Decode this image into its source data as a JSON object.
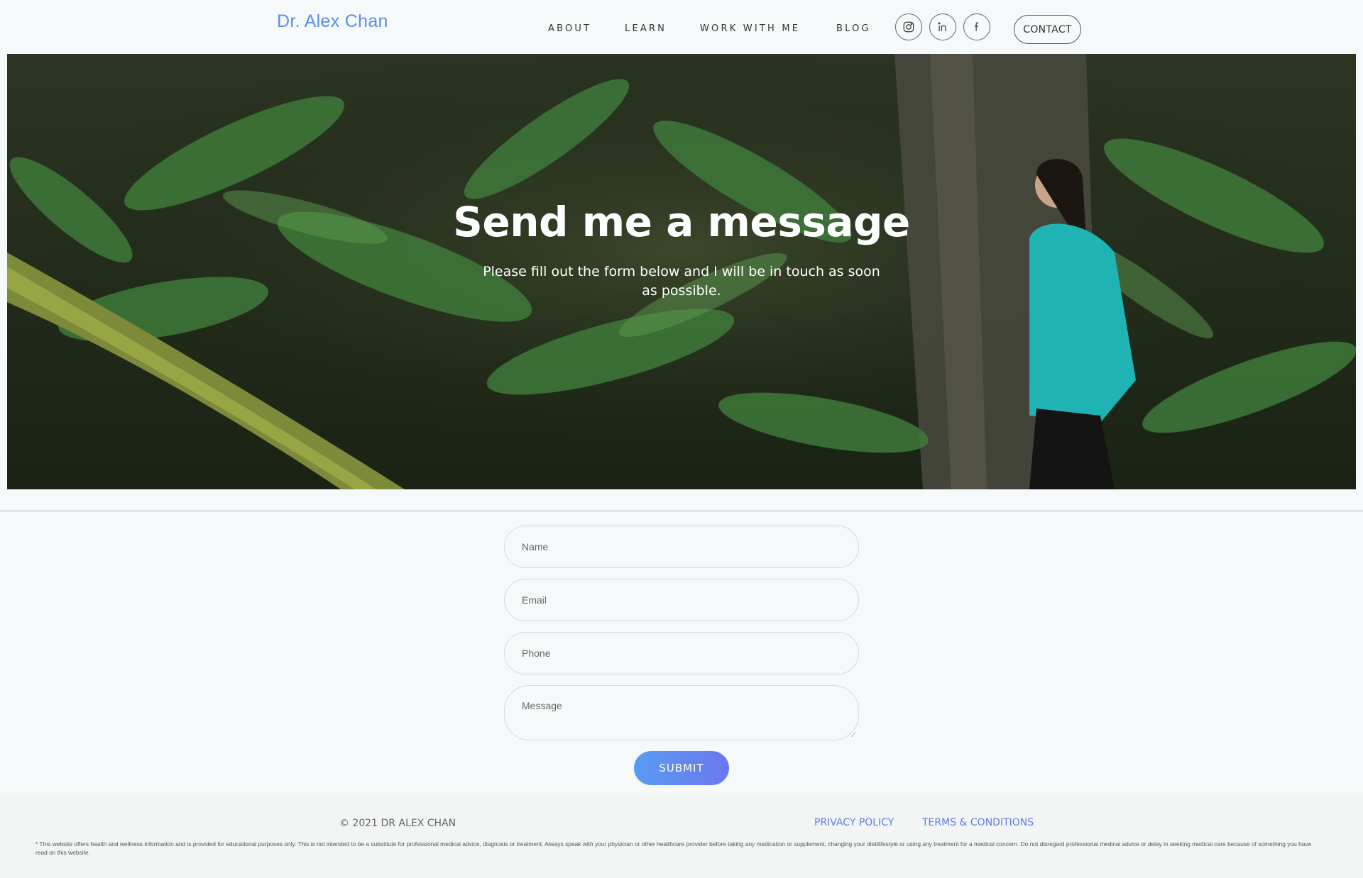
{
  "brand": {
    "logo_text": "Dr. Alex Chan",
    "accent_color": "#5b8ee6"
  },
  "nav": {
    "items": [
      {
        "label": "ABOUT"
      },
      {
        "label": "LEARN"
      },
      {
        "label": "WORK WITH ME"
      },
      {
        "label": "BLOG"
      }
    ],
    "social": [
      {
        "icon": "instagram-icon"
      },
      {
        "icon": "linkedin-icon"
      },
      {
        "icon": "facebook-icon"
      }
    ],
    "contact_label": "CONTACT"
  },
  "hero": {
    "title": "Send me a message",
    "subtitle": "Please fill out the form below and I will be in touch as soon as possible."
  },
  "form": {
    "name_placeholder": "Name",
    "email_placeholder": "Email",
    "phone_placeholder": "Phone",
    "message_placeholder": "Message",
    "submit_label": "SUBMIT"
  },
  "footer": {
    "copyright": "© 2021 DR ALEX CHAN",
    "privacy_label": "PRIVACY POLICY",
    "terms_label": "TERMS & CONDITIONS",
    "disclaimer": "* This website offers health and wellness information and is provided for educational purposes only. This is not intended to be a substitute for professional medical advice, diagnosis or treatment. Always speak with your physician or other healthcare provider before taking any medication or supplement, changing your diet/lifestyle or using any treatment for a medical concern. Do not disregard professional medical advice or delay in seeking medical care because of something you have read on this website."
  }
}
